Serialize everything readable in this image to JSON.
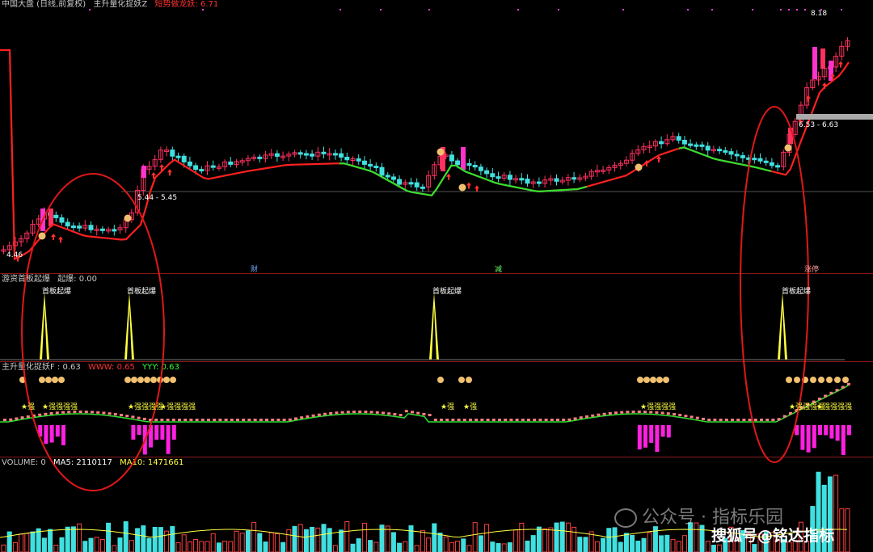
{
  "main_header": {
    "symbol": "中国大盘 (日线,前复权)",
    "indicator": "主升量化捉妖Z",
    "extra": "短势做龙妖: 6.71"
  },
  "main_labels": {
    "price_high": "8.18",
    "price_low": "4.46",
    "range_1": "5.44 - 5.45",
    "range_2": "6.53 - 6.63",
    "event_1": "财",
    "event_2": "减",
    "event_3": "涨停"
  },
  "pane2_header": {
    "title": "游资首板起爆",
    "value": "起爆: 0.00"
  },
  "pane2_signal_label": "首板起爆",
  "pane3_header": {
    "title": "主升量化捉妖F : 0.63",
    "www": "WWW: 0.65",
    "yyy": "YYY: 0.63"
  },
  "pane3_markers": {
    "bag": "💰",
    "strong": "★强",
    "strong_run": "★强强强强"
  },
  "volume_header": {
    "title": "VOLUME: 0",
    "ma5": "MA5: 2110117",
    "ma10": "MA10: 1471661"
  },
  "watermark": {
    "wechat": "公众号 · 指标乐园",
    "sohu": "搜狐号@铭达指标"
  },
  "colors": {
    "up": "#ff3060",
    "down": "#40e0e0",
    "ma_up": "#ff2020",
    "ma_flat": "#30e030",
    "ellipse": "#e01818",
    "signal": "#ffff40"
  }
}
